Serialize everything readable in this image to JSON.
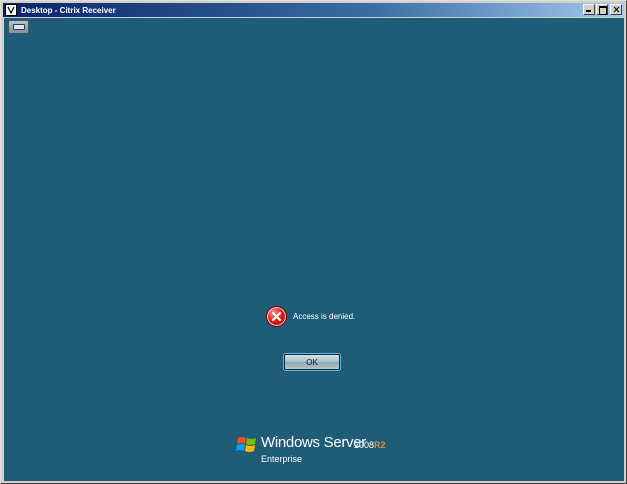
{
  "window": {
    "title": "Desktop - Citrix Receiver",
    "minimize_label": "_",
    "maximize_label": "□",
    "close_label": "×"
  },
  "desktop": {
    "background": "#1e5c78"
  },
  "dialog": {
    "message": "Access is denied.",
    "ok_label": "OK",
    "icon": "error-icon"
  },
  "branding": {
    "product": "Windows Server",
    "version": "2008",
    "release": "R2",
    "edition": "Enterprise"
  }
}
